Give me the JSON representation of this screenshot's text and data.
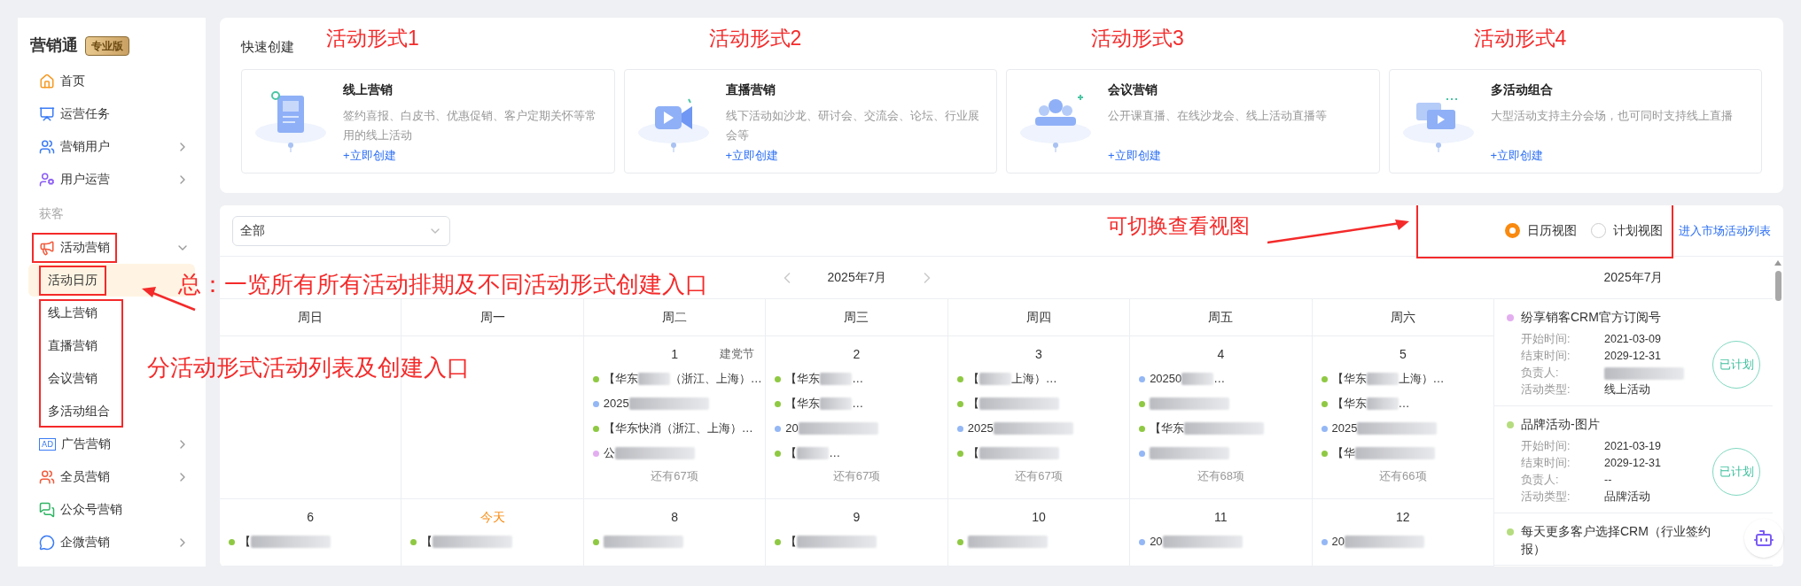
{
  "sidebar": {
    "brand": "营销通",
    "badge": "专业版",
    "items": [
      {
        "kind": "item",
        "label": "首页",
        "has_arrow": false
      },
      {
        "kind": "item",
        "label": "运营任务",
        "has_arrow": false
      },
      {
        "kind": "item",
        "label": "营销用户",
        "has_arrow": true
      },
      {
        "kind": "item",
        "label": "用户运营",
        "has_arrow": true
      },
      {
        "kind": "section",
        "label": "获客"
      },
      {
        "kind": "item",
        "label": "活动营销",
        "has_arrow": true,
        "expanded": true,
        "marked": true,
        "children_marked": true,
        "children": [
          {
            "label": "活动日历",
            "selected": true,
            "marked": true
          },
          {
            "label": "线上营销",
            "selected": false,
            "marked": false
          },
          {
            "label": "直播营销",
            "selected": false,
            "marked": false
          },
          {
            "label": "会议营销",
            "selected": false,
            "marked": false
          },
          {
            "label": "多活动组合",
            "selected": false,
            "marked": false
          }
        ]
      },
      {
        "kind": "item",
        "label": "广告营销",
        "icon_label": "AD",
        "has_arrow": true
      },
      {
        "kind": "item",
        "label": "全员营销",
        "has_arrow": true
      },
      {
        "kind": "item",
        "label": "公众号营销",
        "has_arrow": false
      },
      {
        "kind": "item",
        "label": "企微营销",
        "has_arrow": true
      }
    ]
  },
  "quick_create": {
    "title": "快速创建",
    "cards": [
      {
        "annotation": "活动形式1",
        "title": "线上营销",
        "description": "签约喜报、白皮书、优惠促销、客户定期关怀等常用的线上活动",
        "link": "+立即创建"
      },
      {
        "annotation": "活动形式2",
        "title": "直播营销",
        "description": "线下活动如沙龙、研讨会、交流会、论坛、行业展会等",
        "link": "+立即创建"
      },
      {
        "annotation": "活动形式3",
        "title": "会议营销",
        "description": "公开课直播、在线沙龙会、线上活动直播等",
        "link": "+立即创建"
      },
      {
        "annotation": "活动形式4",
        "title": "多活动组合",
        "description": "大型活动支持主分会场，也可同时支持线上直播",
        "link": "+立即创建"
      }
    ]
  },
  "filter": {
    "value": "全部"
  },
  "view_switch": {
    "marked": true,
    "annotation": "可切换查看视图",
    "options": [
      {
        "label": "日历视图",
        "selected": true
      },
      {
        "label": "计划视图",
        "selected": false
      }
    ],
    "link": "进入市场活动列表"
  },
  "annotations": {
    "overview": "总：一览所有所有活动排期及不同活动形式创建入口",
    "sub_lists": "分活动形式活动列表及创建入口"
  },
  "calendar": {
    "month": "2025年7月",
    "weekdays": [
      "周日",
      "周一",
      "周二",
      "周三",
      "周四",
      "周五",
      "周六"
    ],
    "weeks": [
      [
        {
          "day": "1",
          "holiday": "建党节",
          "more": "还有67项",
          "events": [
            {
              "color": "#8fc943",
              "text": "【华东",
              "redacted": true,
              "suffix": "（浙江、上海）…"
            },
            {
              "color": "#94b7f5",
              "text": "2025",
              "redacted": true
            },
            {
              "color": "#8fc943",
              "text": "【华东快消（浙江、上海）…",
              "redacted": false
            },
            {
              "color": "#e3aef0",
              "text": "公",
              "redacted": true
            }
          ]
        },
        {
          "day": "2",
          "more": "还有67项",
          "events": [
            {
              "color": "#8fc943",
              "text": "【华东",
              "redacted": true,
              "suffix": "…"
            },
            {
              "color": "#8fc943",
              "text": "【华东",
              "redacted": true,
              "suffix": "…"
            },
            {
              "color": "#94b7f5",
              "text": "20",
              "redacted": true
            },
            {
              "color": "#8fc943",
              "text": "【",
              "redacted": true,
              "suffix": "…"
            }
          ]
        },
        {
          "day": "3",
          "more": "还有67项",
          "events": [
            {
              "color": "#8fc943",
              "text": "【",
              "redacted": true,
              "suffix": "上海）…"
            },
            {
              "color": "#8fc943",
              "text": "【",
              "redacted": true
            },
            {
              "color": "#94b7f5",
              "text": "2025",
              "redacted": true
            },
            {
              "color": "#8fc943",
              "text": "【",
              "redacted": true
            }
          ]
        },
        {
          "day": "4",
          "more": "还有68项",
          "events": [
            {
              "color": "#94b7f5",
              "text": "20250",
              "redacted": true,
              "suffix": "…"
            },
            {
              "color": "#8fc943",
              "redacted": true
            },
            {
              "color": "#8fc943",
              "text": "【华东",
              "redacted": true
            },
            {
              "color": "#94b7f5",
              "redacted": true
            }
          ]
        },
        {
          "day": "5",
          "more": "还有66项",
          "events": [
            {
              "color": "#8fc943",
              "text": "【华东",
              "redacted": true,
              "suffix": "上海）…"
            },
            {
              "color": "#8fc943",
              "text": "【华东",
              "redacted": true,
              "suffix": "…"
            },
            {
              "color": "#94b7f5",
              "text": "2025",
              "redacted": true
            },
            {
              "color": "#8fc943",
              "text": "【华",
              "redacted": true
            }
          ]
        }
      ],
      [
        {
          "day": "6",
          "today": false,
          "events": [
            {
              "color": "#8fc943",
              "text": "【",
              "redacted": true
            }
          ]
        },
        {
          "day": "今天",
          "today": true,
          "events": [
            {
              "color": "#8fc943",
              "text": "【",
              "redacted": true
            }
          ]
        },
        {
          "day": "8",
          "today": false,
          "events": [
            {
              "color": "#8fc943",
              "redacted": true
            }
          ]
        },
        {
          "day": "9",
          "today": false,
          "events": [
            {
              "color": "#8fc943",
              "text": "【",
              "redacted": true
            }
          ]
        },
        {
          "day": "10",
          "today": false,
          "events": [
            {
              "color": "#8fc943",
              "redacted": true
            }
          ]
        },
        {
          "day": "11",
          "today": false,
          "events": [
            {
              "color": "#94b7f5",
              "text": "20",
              "redacted": true
            }
          ]
        },
        {
          "day": "12",
          "today": false,
          "events": [
            {
              "color": "#94b7f5",
              "text": "20",
              "redacted": true
            }
          ]
        }
      ]
    ]
  },
  "plan_list": {
    "month": "2025年7月",
    "items": [
      {
        "color": "#e3aef0",
        "title": "纷享销客CRM官方订阅号",
        "status": "已计划",
        "fields": [
          {
            "label": "开始时间:",
            "value": "2021-03-09"
          },
          {
            "label": "结束时间:",
            "value": "2029-12-31"
          },
          {
            "label": "负责人:",
            "redacted": true
          },
          {
            "label": "活动类型:",
            "value": "线上活动"
          }
        ]
      },
      {
        "color": "#b5dc7e",
        "title": "品牌活动-图片",
        "status": "已计划",
        "fields": [
          {
            "label": "开始时间:",
            "value": "2021-03-19"
          },
          {
            "label": "结束时间:",
            "value": "2029-12-31"
          },
          {
            "label": "负责人:",
            "value": "--"
          },
          {
            "label": "活动类型:",
            "value": "品牌活动"
          }
        ]
      },
      {
        "color": "#b5dc7e",
        "title": "每天更多客户选择CRM（行业签约报）"
      }
    ]
  }
}
